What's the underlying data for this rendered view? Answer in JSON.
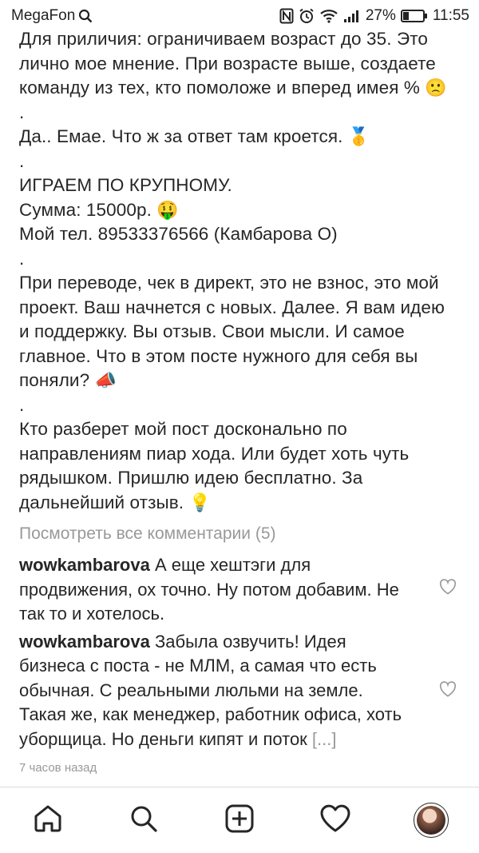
{
  "status": {
    "carrier": "MegaFon",
    "battery": "27%",
    "time": "11:55"
  },
  "caption": {
    "l1": "Для приличия: ограничиваем возраст до 35. Это лично мое мнение. При возрасте выше, создаете команду из тех, кто помоложе и вперед имея % ",
    "l1_emoji": "🙁",
    "dot1": ".",
    "l2": "Да.. Емае. Что ж за ответ там кроется. ",
    "l2_emoji": "🥇",
    "dot2": ".",
    "l3": "ИГРАЕМ ПО КРУПНОМУ.",
    "l4": "Сумма: 15000р. ",
    "l4_emoji": "🤑",
    "l5": "Мой тел. 89533376566 (Камбарова О)",
    "dot3": ".",
    "l6": "При переводе, чек в директ, это не взнос, это мой проект. Ваш начнется с новых. Далее. Я вам идею и поддержку. Вы отзыв. Свои мысли. И самое главное. Что в этом посте нужного для себя вы поняли? ",
    "l6_emoji": "📣",
    "dot4": ".",
    "l7": "Кто разберет мой пост досконально по направлениям пиар хода. Или будет хоть чуть рядышком. Пришлю идею бесплатно. За дальнейший отзыв. ",
    "l7_emoji": "💡"
  },
  "view_all_comments": "Посмотреть все комментарии (5)",
  "comments": [
    {
      "username": "wowkambarova",
      "text": " А еще хештэги для продвижения, ох точно. Ну потом добавим. Не так то и хотелось."
    },
    {
      "username": "wowkambarova",
      "text": " Забыла озвучить! Идея бизнеса с поста - не МЛМ, а самая что есть обычная. С реальными люльми на земле. Такая же, как менеджер, работник офиса, хоть уборщица. Но деньги кипят и поток ",
      "more": "[...]"
    }
  ],
  "timestamp": "7 часов назад",
  "nav": {
    "items": [
      "home-icon",
      "search-icon",
      "add-post-icon",
      "activity-heart-icon",
      "profile-avatar"
    ]
  }
}
